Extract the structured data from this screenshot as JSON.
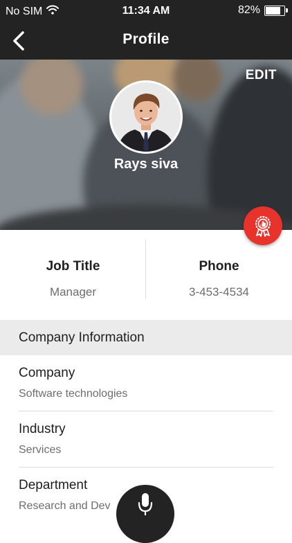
{
  "status_bar": {
    "carrier": "No SIM",
    "time": "11:34 AM",
    "battery": "82%",
    "battery_level": 0.82
  },
  "nav": {
    "title": "Profile"
  },
  "hero": {
    "edit_label": "EDIT",
    "name": "Rays siva"
  },
  "info": {
    "job_title_label": "Job Title",
    "job_title_value": "Manager",
    "phone_label": "Phone",
    "phone_value": "3-453-4534"
  },
  "section": {
    "title": "Company Information"
  },
  "details": [
    {
      "label": "Company",
      "value": "Software technologies"
    },
    {
      "label": "Industry",
      "value": "Services"
    },
    {
      "label": "Department",
      "value": "Research and Dev"
    }
  ],
  "colors": {
    "bar": "#232323",
    "accent": "#e8322c",
    "section_bg": "#ebebeb"
  },
  "icons": {
    "back": "chevron-left-icon",
    "wifi": "wifi-icon",
    "battery": "battery-icon",
    "badge": "award-ribbon-icon",
    "mic": "microphone-icon"
  }
}
